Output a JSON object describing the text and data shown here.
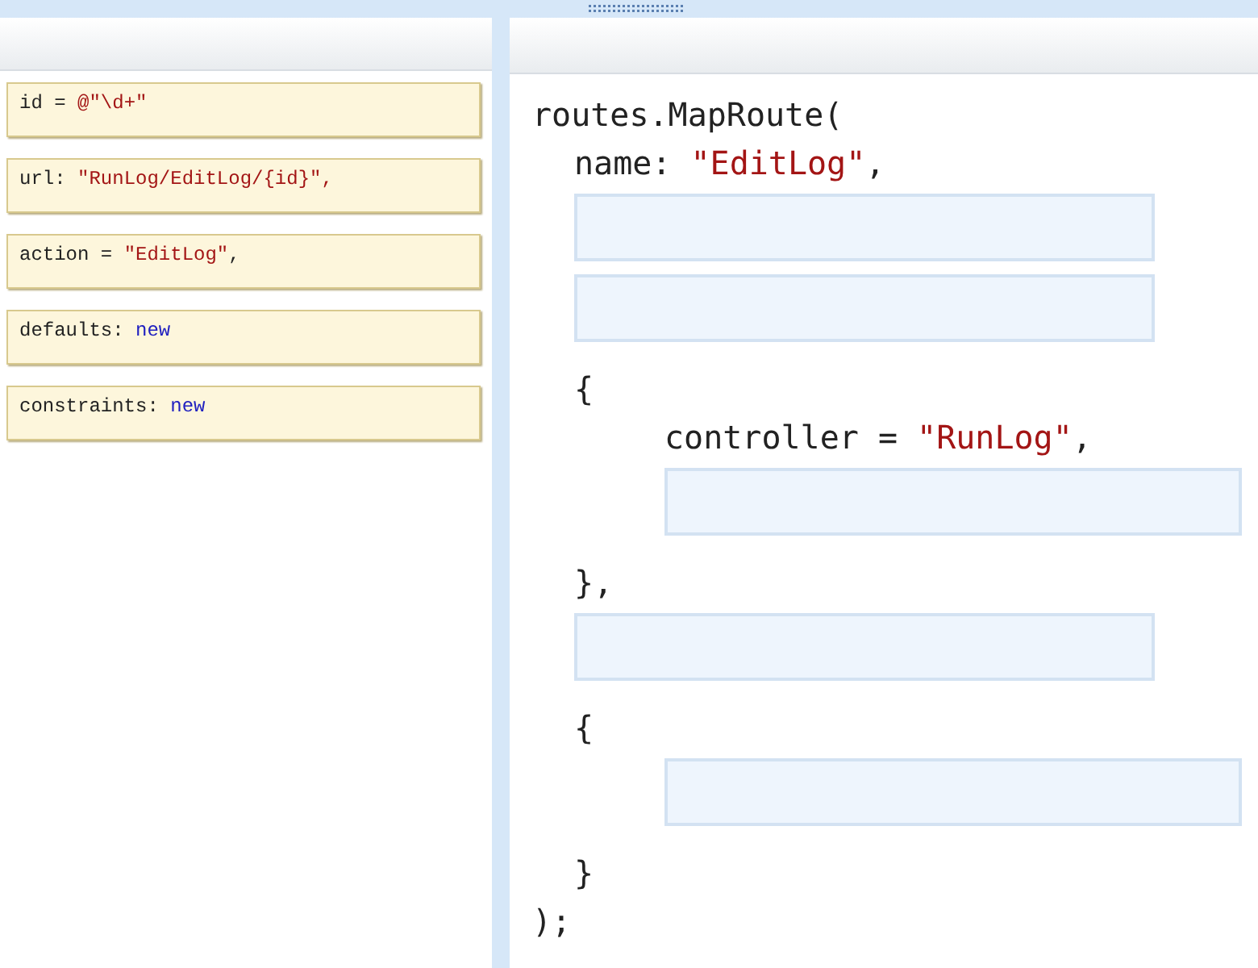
{
  "tiles": [
    {
      "parts": [
        {
          "kind": "plain",
          "text": "id = "
        },
        {
          "kind": "string",
          "text": "@\"\\d+\""
        }
      ]
    },
    {
      "parts": [
        {
          "kind": "plain",
          "text": "url: "
        },
        {
          "kind": "string",
          "text": "\"RunLog/EditLog/{id}\","
        }
      ]
    },
    {
      "parts": [
        {
          "kind": "plain",
          "text": "action = "
        },
        {
          "kind": "string",
          "text": "\"EditLog\""
        },
        {
          "kind": "plain",
          "text": ","
        }
      ]
    },
    {
      "parts": [
        {
          "kind": "plain",
          "text": "defaults: "
        },
        {
          "kind": "keyword",
          "text": "new"
        }
      ]
    },
    {
      "parts": [
        {
          "kind": "plain",
          "text": "constraints: "
        },
        {
          "kind": "keyword",
          "text": "new"
        }
      ]
    }
  ],
  "code": [
    {
      "kind": "top",
      "parts": [
        {
          "kind": "plain",
          "text": "routes.MapRoute("
        }
      ]
    },
    {
      "kind": "arg",
      "parts": [
        {
          "kind": "plain",
          "text": "name: "
        },
        {
          "kind": "string",
          "text": "\"EditLog\""
        },
        {
          "kind": "plain",
          "text": ","
        }
      ]
    },
    {
      "kind": "arg_slot"
    },
    {
      "kind": "arg_slot"
    },
    {
      "kind": "arg",
      "parts": [
        {
          "kind": "plain",
          "text": "{"
        }
      ]
    },
    {
      "kind": "member",
      "parts": [
        {
          "kind": "plain",
          "text": "controller = "
        },
        {
          "kind": "string",
          "text": "\"RunLog\""
        },
        {
          "kind": "plain",
          "text": ","
        }
      ]
    },
    {
      "kind": "member_slot"
    },
    {
      "kind": "arg",
      "parts": [
        {
          "kind": "plain",
          "text": "},"
        }
      ]
    },
    {
      "kind": "arg_slot"
    },
    {
      "kind": "arg",
      "parts": [
        {
          "kind": "plain",
          "text": "{"
        }
      ]
    },
    {
      "kind": "member_slot"
    },
    {
      "kind": "arg",
      "parts": [
        {
          "kind": "plain",
          "text": "}"
        }
      ]
    },
    {
      "kind": "top",
      "parts": [
        {
          "kind": "plain",
          "text": ");"
        }
      ]
    }
  ]
}
